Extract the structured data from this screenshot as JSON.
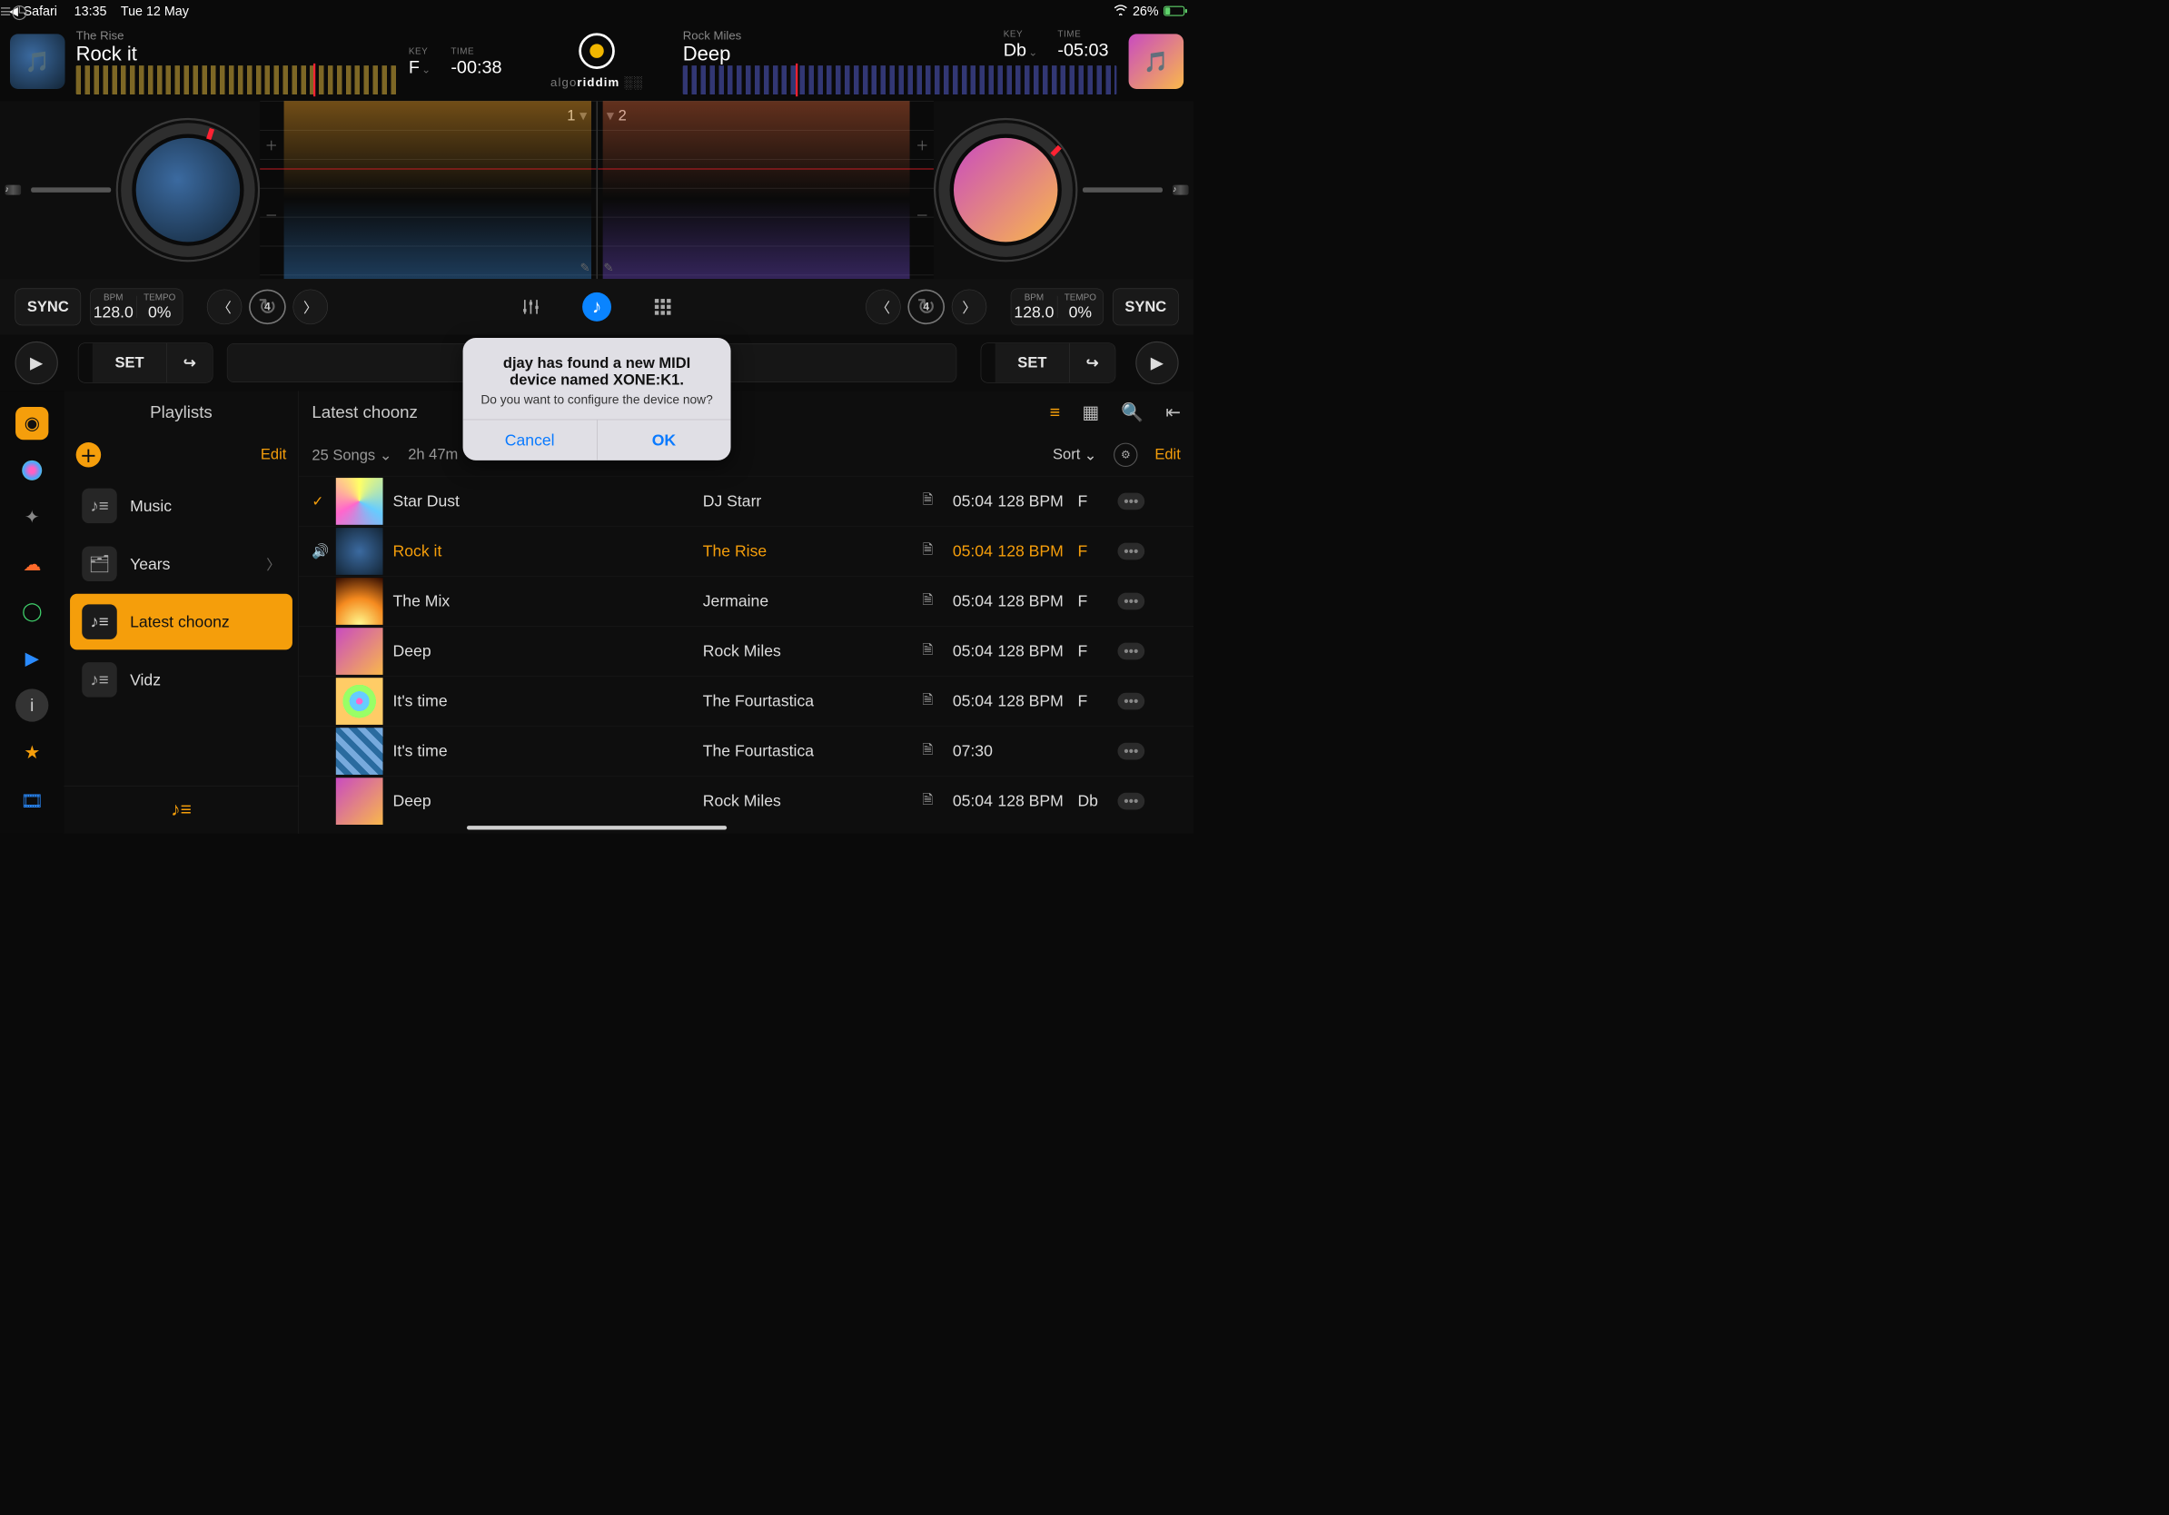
{
  "status": {
    "back_app": "Safari",
    "time": "13:35",
    "date": "Tue 12 May",
    "battery_pct": "26%"
  },
  "logo": {
    "a": "algo",
    "b": "riddim"
  },
  "decks": {
    "left": {
      "artist": "The Rise",
      "title": "Rock it",
      "key_label": "KEY",
      "key": "F",
      "time_label": "TIME",
      "time": "-00:38",
      "deck_num": "1",
      "bpm_label": "BPM",
      "bpm": "128.0",
      "tempo_label": "TEMPO",
      "tempo": "0%",
      "loop": "4",
      "set": "SET",
      "sync": "SYNC"
    },
    "right": {
      "artist": "Rock Miles",
      "title": "Deep",
      "key_label": "KEY",
      "key": "Db",
      "time_label": "TIME",
      "time": "-05:03",
      "deck_num": "2",
      "bpm_label": "BPM",
      "bpm": "128.0",
      "tempo_label": "TEMPO",
      "tempo": "0%",
      "loop": "4",
      "set": "SET",
      "sync": "SYNC"
    }
  },
  "browser": {
    "playlists_header": "Playlists",
    "edit": "Edit",
    "items": [
      {
        "label": "Music",
        "icon": "music"
      },
      {
        "label": "Years",
        "icon": "folder",
        "has_children": true
      },
      {
        "label": "Latest choonz",
        "icon": "music",
        "active": true
      },
      {
        "label": "Vidz",
        "icon": "music"
      }
    ],
    "list_title": "Latest choonz",
    "song_count": "25 Songs",
    "total_time": "2h 47m",
    "sort": "Sort",
    "edit2": "Edit"
  },
  "songs": [
    {
      "title": "Star Dust",
      "artist": "DJ Starr",
      "dur": "05:04",
      "bpm": "128 BPM",
      "key": "F",
      "mark": "check",
      "art": "pat-a"
    },
    {
      "title": "Rock it",
      "artist": "The Rise",
      "dur": "05:04",
      "bpm": "128 BPM",
      "key": "F",
      "mark": "playing",
      "art": "pat-b"
    },
    {
      "title": "The Mix",
      "artist": "Jermaine",
      "dur": "05:04",
      "bpm": "128 BPM",
      "key": "F",
      "art": "pat-c"
    },
    {
      "title": "Deep",
      "artist": "Rock Miles",
      "dur": "05:04",
      "bpm": "128 BPM",
      "key": "F",
      "art": "pat-d"
    },
    {
      "title": "It's time",
      "artist": "The Fourtastica",
      "dur": "05:04",
      "bpm": "128 BPM",
      "key": "F",
      "art": "pat-e"
    },
    {
      "title": "It's time",
      "artist": "The Fourtastica",
      "dur": "07:30",
      "bpm": "",
      "key": "",
      "art": "pat-f"
    },
    {
      "title": "Deep",
      "artist": "Rock Miles",
      "dur": "05:04",
      "bpm": "128 BPM",
      "key": "Db",
      "art": "pat-d"
    }
  ],
  "modal": {
    "title": "djay has found a new MIDI device named XONE:K1.",
    "subtitle": "Do you want to configure the device now?",
    "cancel": "Cancel",
    "ok": "OK"
  }
}
